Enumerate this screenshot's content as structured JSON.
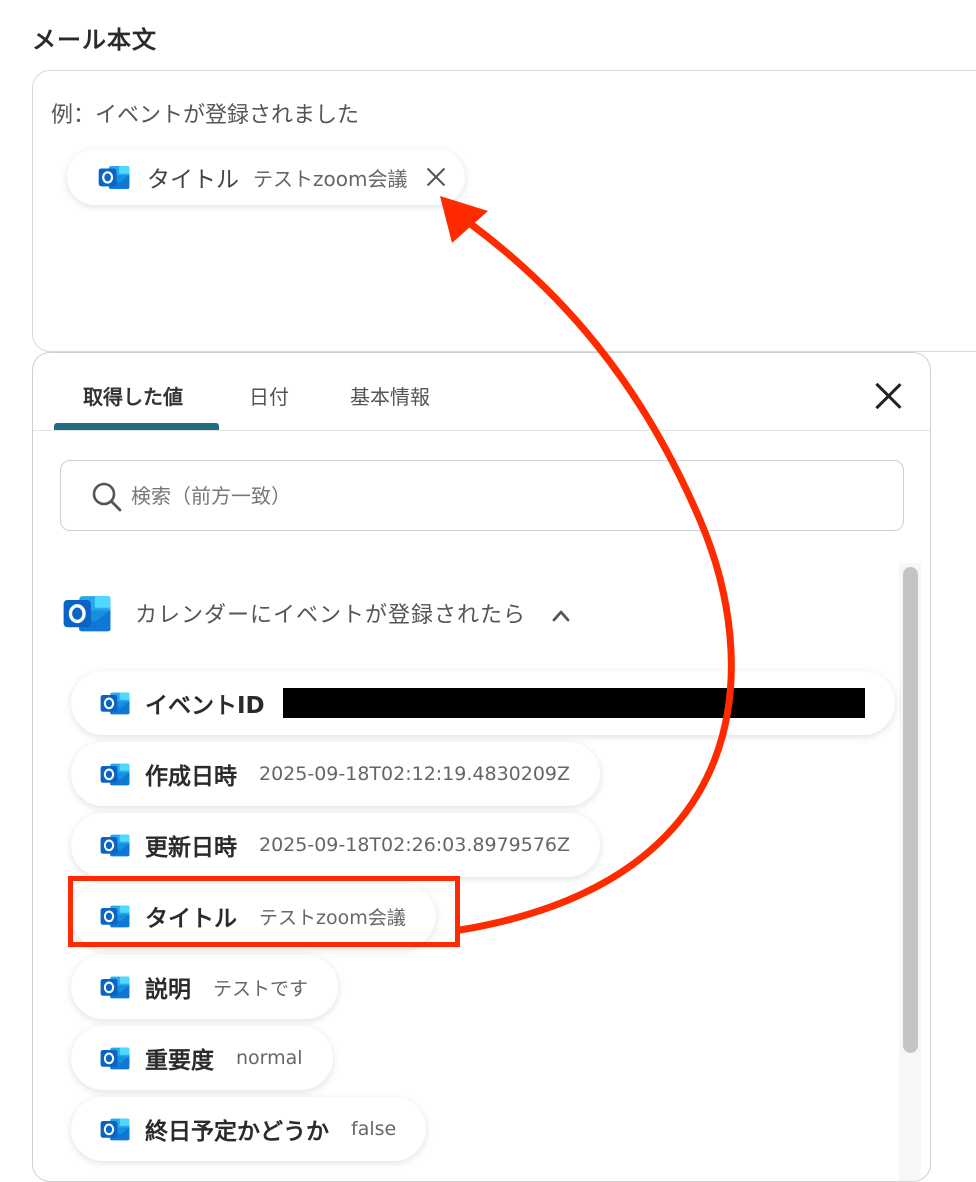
{
  "field": {
    "label": "メール本文",
    "placeholder": "例：イベントが登録されました",
    "inserted_chip": {
      "name": "タイトル",
      "value": "テストzoom会議"
    }
  },
  "panel": {
    "tabs": [
      {
        "label": "取得した値",
        "active": true
      },
      {
        "label": "日付",
        "active": false
      },
      {
        "label": "基本情報",
        "active": false
      }
    ],
    "search_placeholder": "検索（前方一致）",
    "group": {
      "title": "カレンダーにイベントが登録されたら",
      "expanded": true,
      "items": [
        {
          "name": "イベントID",
          "value": "",
          "redacted": true
        },
        {
          "name": "作成日時",
          "value": "2025-09-18T02:12:19.4830209Z"
        },
        {
          "name": "更新日時",
          "value": "2025-09-18T02:26:03.8979576Z"
        },
        {
          "name": "タイトル",
          "value": "テストzoom会議",
          "highlighted": true
        },
        {
          "name": "説明",
          "value": "テストです"
        },
        {
          "name": "重要度",
          "value": "normal"
        },
        {
          "name": "終日予定かどうか",
          "value": "false"
        }
      ]
    }
  },
  "icons": {
    "app": "outlook-icon",
    "search": "search-icon",
    "close": "close-icon",
    "collapse": "chevron-up-icon"
  },
  "colors": {
    "tab_indicator": "#1f6e86",
    "annotation": "#ff2a00",
    "outlook_blue": "#0a64c8"
  }
}
